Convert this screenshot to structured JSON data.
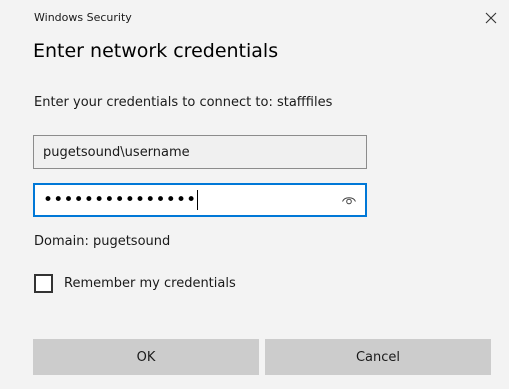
{
  "window": {
    "app_title": "Windows Security",
    "close_icon": "close-icon"
  },
  "dialog": {
    "heading": "Enter network credentials",
    "prompt": "Enter your credentials to connect to: stafffiles",
    "username_value": "pugetsound\\username",
    "password_masked": "•••••••••••••••",
    "reveal_icon": "eye-icon",
    "domain_text": "Domain: pugetsound",
    "remember_label": "Remember my credentials",
    "remember_checked": false
  },
  "buttons": {
    "ok_label": "OK",
    "cancel_label": "Cancel"
  },
  "colors": {
    "focus_border": "#0078d7",
    "button_bg": "#cccccc",
    "dialog_bg": "#f3f3f3"
  }
}
